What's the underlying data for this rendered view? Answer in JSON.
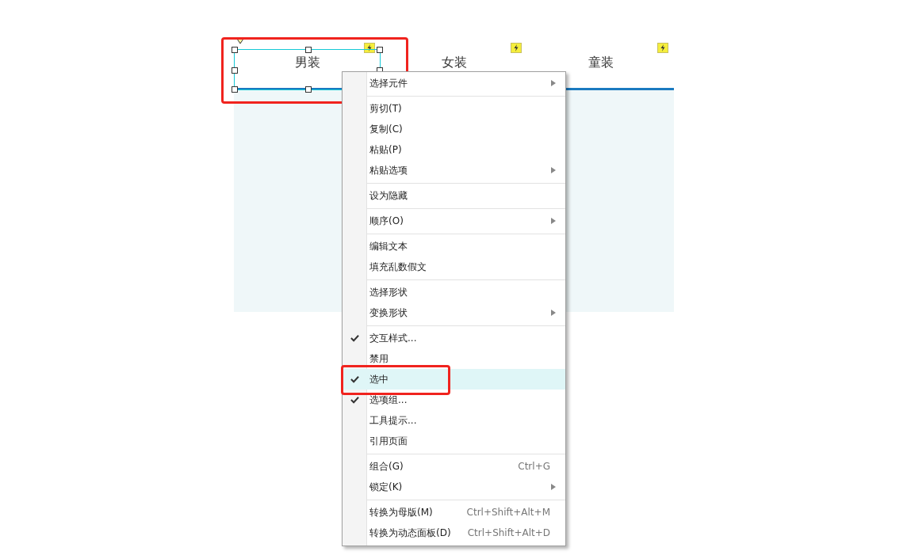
{
  "tabs": [
    {
      "label": "男装",
      "selected": true
    },
    {
      "label": "女装",
      "selected": false
    },
    {
      "label": "童装",
      "selected": false
    }
  ],
  "menu": {
    "items": [
      {
        "kind": "item",
        "label": "选择元件",
        "submenu": true,
        "checked": false,
        "selected": false
      },
      {
        "kind": "separator"
      },
      {
        "kind": "item",
        "label": "剪切(T)",
        "submenu": false,
        "checked": false,
        "selected": false
      },
      {
        "kind": "item",
        "label": "复制(C)",
        "submenu": false,
        "checked": false,
        "selected": false
      },
      {
        "kind": "item",
        "label": "粘贴(P)",
        "submenu": false,
        "checked": false,
        "selected": false
      },
      {
        "kind": "item",
        "label": "粘贴选项",
        "submenu": true,
        "checked": false,
        "selected": false
      },
      {
        "kind": "separator"
      },
      {
        "kind": "item",
        "label": "设为隐藏",
        "submenu": false,
        "checked": false,
        "selected": false
      },
      {
        "kind": "separator"
      },
      {
        "kind": "item",
        "label": "顺序(O)",
        "submenu": true,
        "checked": false,
        "selected": false
      },
      {
        "kind": "separator"
      },
      {
        "kind": "item",
        "label": "编辑文本",
        "submenu": false,
        "checked": false,
        "selected": false
      },
      {
        "kind": "item",
        "label": "填充乱数假文",
        "submenu": false,
        "checked": false,
        "selected": false
      },
      {
        "kind": "separator"
      },
      {
        "kind": "item",
        "label": "选择形状",
        "submenu": false,
        "checked": false,
        "selected": false
      },
      {
        "kind": "item",
        "label": "变换形状",
        "submenu": true,
        "checked": false,
        "selected": false
      },
      {
        "kind": "separator"
      },
      {
        "kind": "item",
        "label": "交互样式...",
        "submenu": false,
        "checked": true,
        "selected": false
      },
      {
        "kind": "item",
        "label": "禁用",
        "submenu": false,
        "checked": false,
        "selected": false
      },
      {
        "kind": "item",
        "label": "选中",
        "submenu": false,
        "checked": true,
        "selected": true
      },
      {
        "kind": "item",
        "label": "选项组...",
        "submenu": false,
        "checked": true,
        "selected": false
      },
      {
        "kind": "item",
        "label": "工具提示...",
        "submenu": false,
        "checked": false,
        "selected": false
      },
      {
        "kind": "item",
        "label": "引用页面",
        "submenu": false,
        "checked": false,
        "selected": false
      },
      {
        "kind": "separator"
      },
      {
        "kind": "item",
        "label": "组合(G)",
        "shortcut": "Ctrl+G",
        "submenu": false,
        "checked": false,
        "selected": false
      },
      {
        "kind": "item",
        "label": "锁定(K)",
        "submenu": true,
        "checked": false,
        "selected": false
      },
      {
        "kind": "separator"
      },
      {
        "kind": "item",
        "label": "转换为母版(M)",
        "shortcut": "Ctrl+Shift+Alt+M",
        "submenu": false,
        "checked": false,
        "selected": false
      },
      {
        "kind": "item",
        "label": "转换为动态面板(D)",
        "shortcut": "Ctrl+Shift+Alt+D",
        "submenu": false,
        "checked": false,
        "selected": false
      }
    ]
  }
}
